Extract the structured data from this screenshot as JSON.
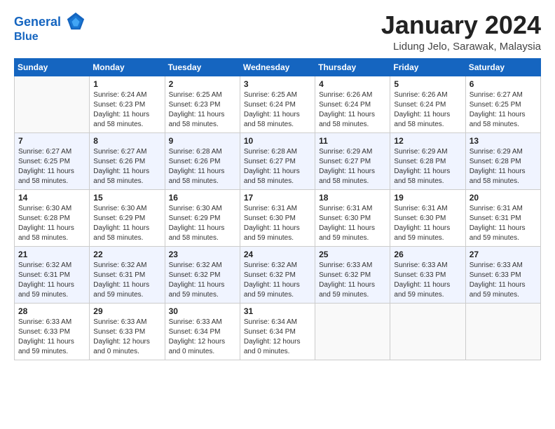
{
  "header": {
    "logo_line1": "General",
    "logo_line2": "Blue",
    "month_title": "January 2024",
    "location": "Lidung Jelo, Sarawak, Malaysia"
  },
  "days_of_week": [
    "Sunday",
    "Monday",
    "Tuesday",
    "Wednesday",
    "Thursday",
    "Friday",
    "Saturday"
  ],
  "weeks": [
    [
      {
        "day": "",
        "content": ""
      },
      {
        "day": "1",
        "content": "Sunrise: 6:24 AM\nSunset: 6:23 PM\nDaylight: 11 hours\nand 58 minutes."
      },
      {
        "day": "2",
        "content": "Sunrise: 6:25 AM\nSunset: 6:23 PM\nDaylight: 11 hours\nand 58 minutes."
      },
      {
        "day": "3",
        "content": "Sunrise: 6:25 AM\nSunset: 6:24 PM\nDaylight: 11 hours\nand 58 minutes."
      },
      {
        "day": "4",
        "content": "Sunrise: 6:26 AM\nSunset: 6:24 PM\nDaylight: 11 hours\nand 58 minutes."
      },
      {
        "day": "5",
        "content": "Sunrise: 6:26 AM\nSunset: 6:24 PM\nDaylight: 11 hours\nand 58 minutes."
      },
      {
        "day": "6",
        "content": "Sunrise: 6:27 AM\nSunset: 6:25 PM\nDaylight: 11 hours\nand 58 minutes."
      }
    ],
    [
      {
        "day": "7",
        "content": "Sunrise: 6:27 AM\nSunset: 6:25 PM\nDaylight: 11 hours\nand 58 minutes."
      },
      {
        "day": "8",
        "content": "Sunrise: 6:27 AM\nSunset: 6:26 PM\nDaylight: 11 hours\nand 58 minutes."
      },
      {
        "day": "9",
        "content": "Sunrise: 6:28 AM\nSunset: 6:26 PM\nDaylight: 11 hours\nand 58 minutes."
      },
      {
        "day": "10",
        "content": "Sunrise: 6:28 AM\nSunset: 6:27 PM\nDaylight: 11 hours\nand 58 minutes."
      },
      {
        "day": "11",
        "content": "Sunrise: 6:29 AM\nSunset: 6:27 PM\nDaylight: 11 hours\nand 58 minutes."
      },
      {
        "day": "12",
        "content": "Sunrise: 6:29 AM\nSunset: 6:28 PM\nDaylight: 11 hours\nand 58 minutes."
      },
      {
        "day": "13",
        "content": "Sunrise: 6:29 AM\nSunset: 6:28 PM\nDaylight: 11 hours\nand 58 minutes."
      }
    ],
    [
      {
        "day": "14",
        "content": "Sunrise: 6:30 AM\nSunset: 6:28 PM\nDaylight: 11 hours\nand 58 minutes."
      },
      {
        "day": "15",
        "content": "Sunrise: 6:30 AM\nSunset: 6:29 PM\nDaylight: 11 hours\nand 58 minutes."
      },
      {
        "day": "16",
        "content": "Sunrise: 6:30 AM\nSunset: 6:29 PM\nDaylight: 11 hours\nand 58 minutes."
      },
      {
        "day": "17",
        "content": "Sunrise: 6:31 AM\nSunset: 6:30 PM\nDaylight: 11 hours\nand 59 minutes."
      },
      {
        "day": "18",
        "content": "Sunrise: 6:31 AM\nSunset: 6:30 PM\nDaylight: 11 hours\nand 59 minutes."
      },
      {
        "day": "19",
        "content": "Sunrise: 6:31 AM\nSunset: 6:30 PM\nDaylight: 11 hours\nand 59 minutes."
      },
      {
        "day": "20",
        "content": "Sunrise: 6:31 AM\nSunset: 6:31 PM\nDaylight: 11 hours\nand 59 minutes."
      }
    ],
    [
      {
        "day": "21",
        "content": "Sunrise: 6:32 AM\nSunset: 6:31 PM\nDaylight: 11 hours\nand 59 minutes."
      },
      {
        "day": "22",
        "content": "Sunrise: 6:32 AM\nSunset: 6:31 PM\nDaylight: 11 hours\nand 59 minutes."
      },
      {
        "day": "23",
        "content": "Sunrise: 6:32 AM\nSunset: 6:32 PM\nDaylight: 11 hours\nand 59 minutes."
      },
      {
        "day": "24",
        "content": "Sunrise: 6:32 AM\nSunset: 6:32 PM\nDaylight: 11 hours\nand 59 minutes."
      },
      {
        "day": "25",
        "content": "Sunrise: 6:33 AM\nSunset: 6:32 PM\nDaylight: 11 hours\nand 59 minutes."
      },
      {
        "day": "26",
        "content": "Sunrise: 6:33 AM\nSunset: 6:33 PM\nDaylight: 11 hours\nand 59 minutes."
      },
      {
        "day": "27",
        "content": "Sunrise: 6:33 AM\nSunset: 6:33 PM\nDaylight: 11 hours\nand 59 minutes."
      }
    ],
    [
      {
        "day": "28",
        "content": "Sunrise: 6:33 AM\nSunset: 6:33 PM\nDaylight: 11 hours\nand 59 minutes."
      },
      {
        "day": "29",
        "content": "Sunrise: 6:33 AM\nSunset: 6:33 PM\nDaylight: 12 hours\nand 0 minutes."
      },
      {
        "day": "30",
        "content": "Sunrise: 6:33 AM\nSunset: 6:34 PM\nDaylight: 12 hours\nand 0 minutes."
      },
      {
        "day": "31",
        "content": "Sunrise: 6:34 AM\nSunset: 6:34 PM\nDaylight: 12 hours\nand 0 minutes."
      },
      {
        "day": "",
        "content": ""
      },
      {
        "day": "",
        "content": ""
      },
      {
        "day": "",
        "content": ""
      }
    ]
  ]
}
